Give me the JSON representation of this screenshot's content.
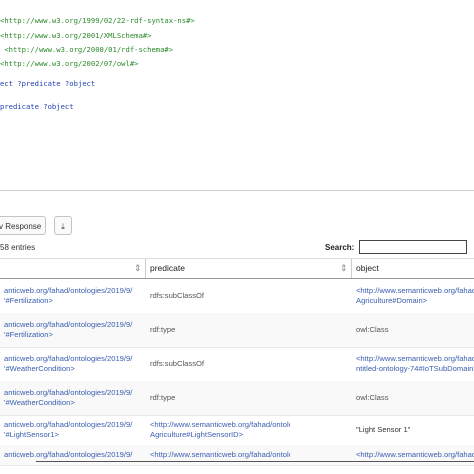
{
  "editor": {
    "prefix_lines": [
      "<http://www.w3.org/1999/02/22-rdf-syntax-ns#>",
      "<http://www.w3.org/2001/XMLSchema#>",
      " <http://www.w3.org/2000/01/rdf-schema#>",
      "<http://www.w3.org/2002/07/owl#>"
    ],
    "query_line_1": "ect ?predicate ?object",
    "query_line_2": "predicate ?object"
  },
  "toolbar": {
    "response_label": "v Response",
    "download_icon": "⤓"
  },
  "table_controls": {
    "entries_text": "58 entries",
    "search_label": "Search:",
    "search_value": ""
  },
  "columns": [
    "",
    "predicate",
    "object"
  ],
  "rows": [
    {
      "subject": [
        "anticweb.org/fahad/ontologies/2019/9/",
        "'#Fertilization>"
      ],
      "predicate": [
        "rdfs:subClassOf"
      ],
      "object": [
        "<http://www.semanticweb.org/fahad/onto",
        "Agriculture#Domain>"
      ]
    },
    {
      "subject": [
        "anticweb.org/fahad/ontologies/2019/9/",
        "'#Fertilization>"
      ],
      "predicate": [
        "rdf:type"
      ],
      "object": [
        "owl:Class"
      ]
    },
    {
      "subject": [
        "anticweb.org/fahad/ontologies/2019/9/",
        "'#WeatherCondition>"
      ],
      "predicate": [
        "rdfs:subClassOf"
      ],
      "object": [
        "<http://www.semanticweb.org/fahad/onto",
        "ntitled-ontology-74#IoTSubDomain>"
      ]
    },
    {
      "subject": [
        "anticweb.org/fahad/ontologies/2019/9/",
        "'#WeatherCondition>"
      ],
      "predicate": [
        "rdf:type"
      ],
      "object": [
        "owl:Class"
      ]
    },
    {
      "subject": [
        "anticweb.org/fahad/ontologies/2019/9/",
        "'#LightSensor1>"
      ],
      "predicate": [
        "<http://www.semanticweb.org/fahad/ontologies/2019/9/",
        "Agriculture#LightSensorID>"
      ],
      "object": [
        "\"Light Sensor 1\""
      ]
    },
    {
      "subject": [
        "anticweb.org/fahad/ontologies/2019/9/"
      ],
      "predicate": [
        "<http://www.semanticweb.org/fahad/ontologies/2019/9/"
      ],
      "object": [
        "<http://www.semanticweb.org/fahad/onto"
      ]
    }
  ]
}
